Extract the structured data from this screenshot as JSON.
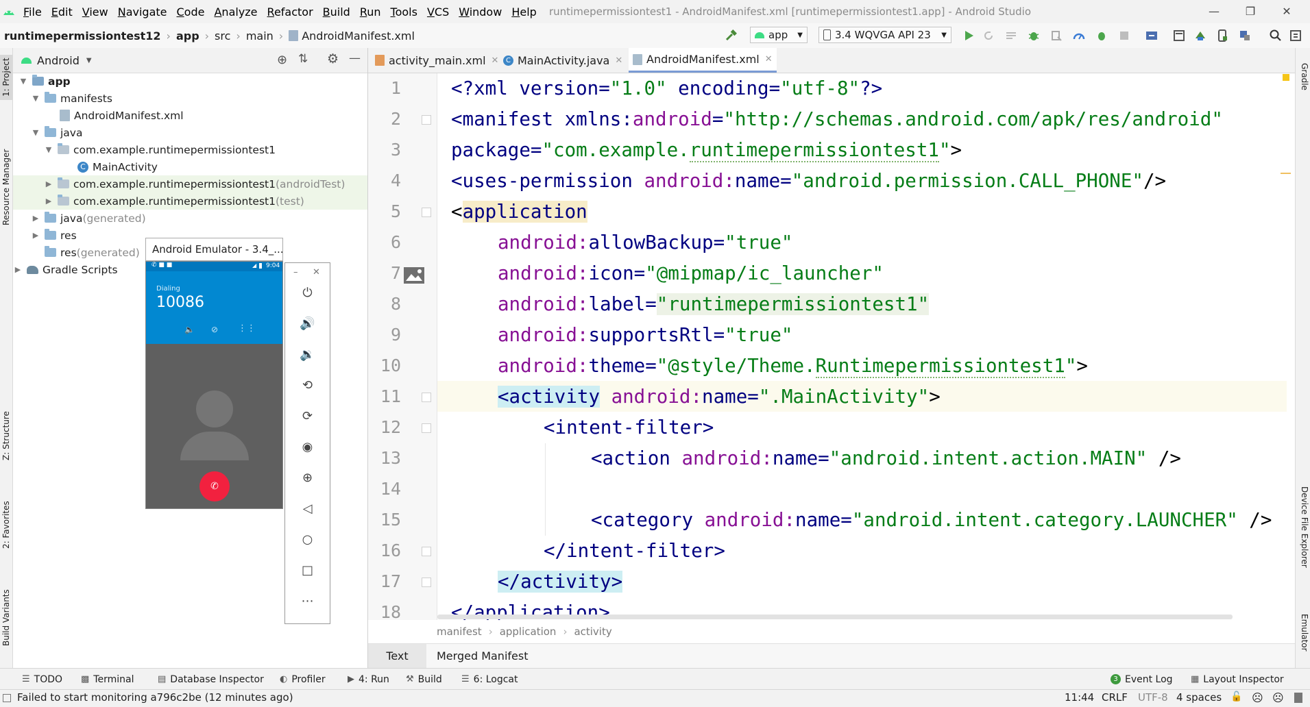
{
  "menubar": {
    "items": [
      "File",
      "Edit",
      "View",
      "Navigate",
      "Code",
      "Analyze",
      "Refactor",
      "Build",
      "Run",
      "Tools",
      "VCS",
      "Window",
      "Help"
    ],
    "window_title": "runtimepermissiontest1 - AndroidManifest.xml [runtimepermissiontest1.app] - Android Studio"
  },
  "navbar": {
    "crumbs": [
      "runtimepermissiontest12",
      "app",
      "src",
      "main",
      "AndroidManifest.xml"
    ],
    "run_config": "app",
    "device": "3.4  WQVGA API 23"
  },
  "left_strip": {
    "project": "1: Project",
    "resource_manager": "Resource Manager",
    "structure": "Z: Structure",
    "favorites": "2: Favorites",
    "build_variants": "Build Variants"
  },
  "right_strip": {
    "gradle": "Gradle",
    "device_file_explorer": "Device File Explorer",
    "emulator": "Emulator"
  },
  "project_panel": {
    "view_mode": "Android",
    "tree": [
      {
        "label": "app",
        "suffix": ""
      },
      {
        "label": "manifests",
        "suffix": ""
      },
      {
        "label": "AndroidManifest.xml",
        "suffix": ""
      },
      {
        "label": "java",
        "suffix": ""
      },
      {
        "label": "com.example.runtimepermissiontest1",
        "suffix": ""
      },
      {
        "label": "MainActivity",
        "suffix": ""
      },
      {
        "label": "com.example.runtimepermissiontest1",
        "suffix": " (androidTest)"
      },
      {
        "label": "com.example.runtimepermissiontest1",
        "suffix": " (test)"
      },
      {
        "label": "java",
        "suffix": " (generated)"
      },
      {
        "label": "res",
        "suffix": ""
      },
      {
        "label": "res",
        "suffix": " (generated)"
      },
      {
        "label": "Gradle Scripts",
        "suffix": ""
      }
    ]
  },
  "emulator": {
    "title": "Android Emulator - 3.4_...",
    "status_time": "9:04",
    "call_state": "Dialing",
    "number": "10086"
  },
  "tabs": [
    {
      "label": "activity_main.xml",
      "icon": "xml-file-icon"
    },
    {
      "label": "MainActivity.java",
      "icon": "class-icon"
    },
    {
      "label": "AndroidManifest.xml",
      "icon": "manifest-icon"
    }
  ],
  "editor": {
    "line_numbers": [
      "1",
      "2",
      "3",
      "4",
      "5",
      "6",
      "7",
      "8",
      "9",
      "10",
      "11",
      "12",
      "13",
      "14",
      "15",
      "16",
      "17",
      "18"
    ],
    "lines": {
      "l1": {
        "a": "<?xml ",
        "b": "version=",
        "c": "\"1.0\"",
        "d": " encoding=",
        "e": "\"utf-8\"",
        "f": "?>"
      },
      "l2": {
        "a": "<manifest ",
        "b": "xmlns:",
        "c": "android",
        "d": "=",
        "e": "\"http://schemas.android.com/apk/res/android\""
      },
      "l3": {
        "a": "package=",
        "b": "\"com.example.",
        "c": "runtimepermissiontest1",
        "d": "\"",
        "e": ">"
      },
      "l4": {
        "a": "<uses-permission ",
        "b": "android:",
        "c": "name=",
        "d": "\"android.permission.CALL_PHONE\"",
        "e": "/>"
      },
      "l5": {
        "a": "<",
        "b": "application"
      },
      "l6": {
        "a": "android:",
        "b": "allowBackup=",
        "c": "\"true\""
      },
      "l7": {
        "a": "android:",
        "b": "icon=",
        "c": "\"@mipmap/ic_launcher\""
      },
      "l8": {
        "a": "android:",
        "b": "label=",
        "c": "\"runtimepermissiontest1\""
      },
      "l9": {
        "a": "android:",
        "b": "supportsRtl=",
        "c": "\"true\""
      },
      "l10": {
        "a": "android:",
        "b": "theme=",
        "c": "\"@style/Theme.",
        "d": "Runtimepermissiontest1",
        "e": "\"",
        "f": ">"
      },
      "l11": {
        "a": "<activity",
        "b": " android:",
        "c": "name=",
        "d": "\".MainActivity\"",
        "e": ">"
      },
      "l12": {
        "a": "<intent-filter>"
      },
      "l13": {
        "a": "<action ",
        "b": "android:",
        "c": "name=",
        "d": "\"android.intent.action.MAIN\"",
        "e": " />"
      },
      "l15": {
        "a": "<category ",
        "b": "android:",
        "c": "name=",
        "d": "\"android.intent.category.LAUNCHER\"",
        "e": " />"
      },
      "l16": {
        "a": "</intent-filter>"
      },
      "l17": {
        "a": "</activity>"
      },
      "l18": {
        "a": "</application>"
      }
    },
    "breadcrumb": [
      "manifest",
      "application",
      "activity"
    ],
    "bottom_tabs": [
      "Text",
      "Merged Manifest"
    ]
  },
  "tool_windows": {
    "todo": "TODO",
    "terminal": "Terminal",
    "database": "Database Inspector",
    "profiler": "Profiler",
    "run": "4: Run",
    "build": "Build",
    "logcat": "6: Logcat",
    "event_log": "Event Log",
    "event_count": "3",
    "layout_inspector": "Layout Inspector"
  },
  "statusbar": {
    "message": "Failed to start monitoring a796c2be (12 minutes ago)",
    "position": "11:44",
    "line_sep": "CRLF",
    "encoding": "UTF-8",
    "indent": "4 spaces"
  },
  "colors": {
    "tag": "#000080",
    "attr": "#871094",
    "value": "#067d17",
    "android_green": "#3ddc84",
    "emulator_blue": "#0288d1"
  }
}
